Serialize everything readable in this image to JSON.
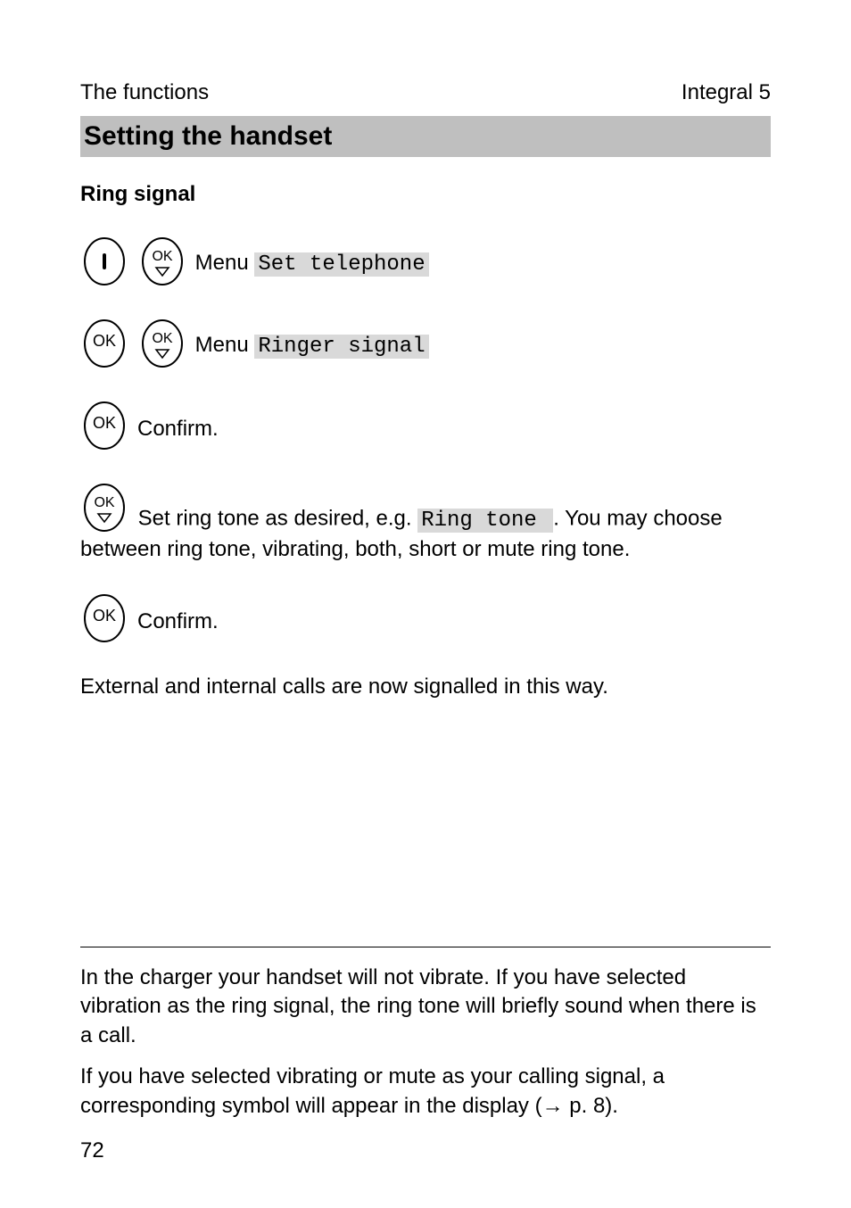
{
  "header": {
    "left": "The functions",
    "right": "Integral 5"
  },
  "title": "Setting the handset",
  "subheading": "Ring signal",
  "steps": {
    "s1": {
      "prefix": "Menu ",
      "code": "Set telephone "
    },
    "s2": {
      "prefix": "Menu ",
      "code": "Ringer signal "
    },
    "s3": {
      "text": "Confirm."
    },
    "s4": {
      "pre": "Set ring tone as desired, e.g. ",
      "code": "Ring tone ",
      "post": ". You may choose between ring tone, vibrating, both, short or mute ring tone."
    },
    "s5": {
      "text": "Confirm."
    }
  },
  "body_after": "External and internal calls are now signalled in this way.",
  "notes": {
    "n1": "In the charger your handset will not vibrate. If you have selected vibration as the ring signal, the ring tone will briefly sound when there is a call.",
    "n2_pre": "If you have selected vibrating or mute as your calling signal, a corresponding symbol will appear in the display (",
    "n2_arrow": "→",
    "n2_post": " p. 8)."
  },
  "page_number": "72"
}
